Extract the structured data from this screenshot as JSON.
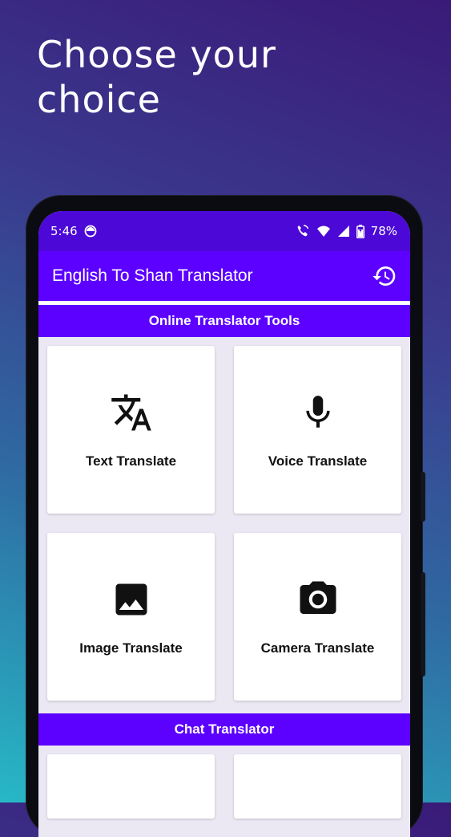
{
  "promo": {
    "title": "Choose your choice"
  },
  "status_bar": {
    "time": "5:46",
    "battery": "78%"
  },
  "app_bar": {
    "title": "English To Shan Translator"
  },
  "sections": {
    "online_tools": "Online Translator Tools",
    "chat": "Chat Translator"
  },
  "tools": [
    {
      "label": "Text Translate",
      "icon": "translate-icon"
    },
    {
      "label": "Voice Translate",
      "icon": "microphone-icon"
    },
    {
      "label": "Image Translate",
      "icon": "image-icon"
    },
    {
      "label": "Camera Translate",
      "icon": "camera-icon"
    }
  ],
  "colors": {
    "primary": "#5c00ff",
    "status_bar": "#4c08d6",
    "background": "#ece8f3"
  }
}
